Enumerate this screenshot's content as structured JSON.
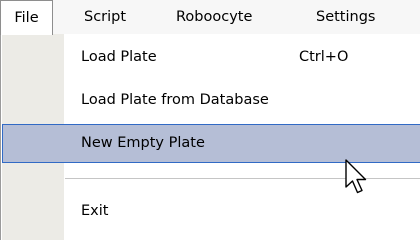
{
  "menubar": {
    "items": [
      {
        "label": "File",
        "active": true
      },
      {
        "label": "Script",
        "active": false
      },
      {
        "label": "Roboocyte",
        "active": false
      },
      {
        "label": "Settings",
        "active": false
      }
    ]
  },
  "file_menu": {
    "items": [
      {
        "label": "Load Plate",
        "shortcut": "Ctrl+O",
        "highlighted": false
      },
      {
        "label": "Load Plate from Database",
        "shortcut": "",
        "highlighted": false
      },
      {
        "label": "New Empty Plate",
        "shortcut": "",
        "highlighted": true
      },
      {
        "label": "Exit",
        "shortcut": "",
        "highlighted": false
      }
    ]
  },
  "colors": {
    "highlight_fill": "#b5bed6",
    "highlight_border": "#316ac5",
    "gutter": "#ecebe6",
    "menubar": "#f7f7f7"
  },
  "cursor_icon": "arrow-pointer"
}
